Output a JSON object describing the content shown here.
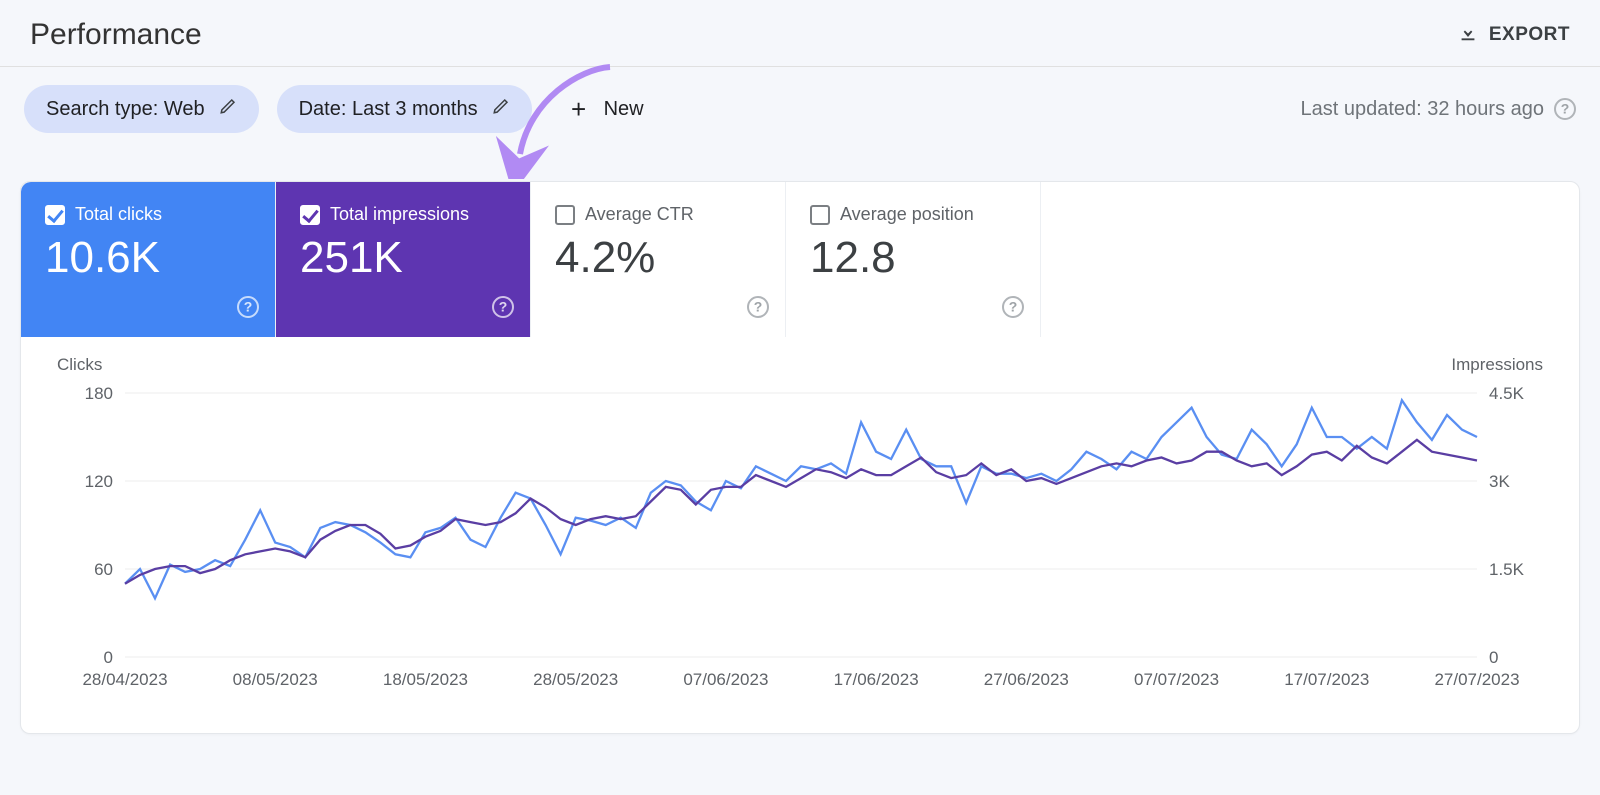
{
  "header": {
    "title": "Performance",
    "export_label": "EXPORT"
  },
  "filters": {
    "search_type_chip": "Search type: Web",
    "date_chip": "Date: Last 3 months",
    "add_new_label": "New",
    "last_updated": "Last updated: 32 hours ago"
  },
  "metrics": {
    "total_clicks": {
      "label": "Total clicks",
      "value": "10.6K",
      "checked": true
    },
    "total_impressions": {
      "label": "Total impressions",
      "value": "251K",
      "checked": true
    },
    "average_ctr": {
      "label": "Average CTR",
      "value": "4.2%",
      "checked": false
    },
    "average_position": {
      "label": "Average position",
      "value": "12.8",
      "checked": false
    }
  },
  "chart_axis": {
    "left_title": "Clicks",
    "right_title": "Impressions",
    "left_ticks": [
      "180",
      "120",
      "60",
      "0"
    ],
    "right_ticks": [
      "4.5K",
      "3K",
      "1.5K",
      "0"
    ],
    "x_ticks": [
      "28/04/2023",
      "08/05/2023",
      "18/05/2023",
      "28/05/2023",
      "07/06/2023",
      "17/06/2023",
      "27/06/2023",
      "07/07/2023",
      "17/07/2023",
      "27/07/2023"
    ]
  },
  "chart_data": {
    "type": "line",
    "xlabel": "",
    "ylabel_left": "Clicks",
    "ylabel_right": "Impressions",
    "ylim_left": [
      0,
      180
    ],
    "ylim_right": [
      0,
      4500
    ],
    "x_start": "28/04/2023",
    "x_end": "27/07/2023",
    "n_points": 91,
    "series": [
      {
        "name": "Clicks",
        "axis": "left",
        "color": "#5a8ff2",
        "values": [
          50,
          60,
          40,
          63,
          58,
          60,
          66,
          62,
          80,
          100,
          78,
          75,
          68,
          88,
          92,
          90,
          85,
          78,
          70,
          68,
          85,
          88,
          95,
          80,
          75,
          95,
          112,
          108,
          90,
          70,
          95,
          93,
          90,
          95,
          88,
          112,
          120,
          117,
          106,
          100,
          120,
          115,
          130,
          125,
          120,
          130,
          128,
          132,
          125,
          160,
          140,
          135,
          155,
          135,
          130,
          130,
          105,
          130,
          125,
          125,
          122,
          125,
          120,
          128,
          140,
          135,
          128,
          140,
          135,
          150,
          160,
          170,
          150,
          138,
          135,
          155,
          145,
          130,
          145,
          170,
          150,
          150,
          142,
          150,
          142,
          175,
          160,
          148,
          165,
          155,
          150
        ]
      },
      {
        "name": "Impressions",
        "axis": "right",
        "color": "#5a3ea3",
        "values": [
          1250,
          1400,
          1500,
          1550,
          1550,
          1430,
          1500,
          1650,
          1750,
          1800,
          1850,
          1800,
          1700,
          2000,
          2150,
          2250,
          2250,
          2100,
          1850,
          1900,
          2050,
          2150,
          2350,
          2300,
          2250,
          2300,
          2450,
          2700,
          2550,
          2350,
          2250,
          2350,
          2400,
          2350,
          2400,
          2650,
          2900,
          2850,
          2600,
          2850,
          2900,
          2900,
          3100,
          3000,
          2900,
          3050,
          3200,
          3150,
          3050,
          3200,
          3100,
          3100,
          3250,
          3400,
          3150,
          3050,
          3100,
          3300,
          3100,
          3200,
          3000,
          3050,
          2950,
          3050,
          3150,
          3250,
          3300,
          3250,
          3350,
          3400,
          3300,
          3350,
          3500,
          3500,
          3350,
          3250,
          3300,
          3100,
          3250,
          3450,
          3500,
          3350,
          3600,
          3400,
          3300,
          3500,
          3700,
          3500,
          3450,
          3400,
          3350
        ]
      }
    ]
  }
}
